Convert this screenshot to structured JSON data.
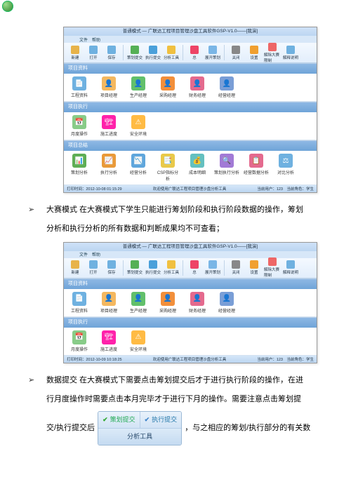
{
  "ss1": {
    "title": "普通模式 — 广联达工程项目管理沙盘工具软件GSP-V1.0——[我演]",
    "tabs": [
      "文件",
      "帮助"
    ],
    "ribbon": [
      {
        "label": "新建",
        "c": "#e7b34a"
      },
      {
        "label": "打开",
        "c": "#6fb1e0"
      },
      {
        "label": "保存",
        "c": "#6fb1e0"
      },
      {
        "label": "策划提交",
        "c": "#55b055"
      },
      {
        "label": "执行提交",
        "c": "#4aa0da"
      },
      {
        "label": "分析工具",
        "c": "#f0c040"
      },
      {
        "label": "总",
        "c": "#e46"
      },
      {
        "label": "展开策划",
        "c": "#7ab6e6"
      },
      {
        "label": "关闭",
        "c": "#888"
      },
      {
        "label": "设置",
        "c": "#f0a030"
      },
      {
        "label": "解除大赛限制",
        "c": "#e66"
      },
      {
        "label": "解释说明",
        "c": "#6fb1e0"
      }
    ],
    "sections": [
      {
        "title": "项目资料",
        "items": [
          {
            "label": "工程资料",
            "c": "#6fb1e0",
            "g": "📄"
          },
          {
            "label": "项目经理",
            "c": "#f4b860",
            "g": "👤"
          },
          {
            "label": "生产经理",
            "c": "#62c06b",
            "g": "👤"
          },
          {
            "label": "采购经理",
            "c": "#f28f3b",
            "g": "👤"
          },
          {
            "label": "财务经理",
            "c": "#e46a8e",
            "g": "👤"
          },
          {
            "label": "经营经理",
            "c": "#7a9ed6",
            "g": "👤"
          }
        ]
      },
      {
        "title": "项目执行",
        "items": [
          {
            "label": "月度操作",
            "c": "#8c8",
            "g": "📅"
          },
          {
            "label": "施工进度",
            "c": "#f2a",
            "g": "🏗"
          },
          {
            "label": "安全环境",
            "c": "#fb4",
            "g": "⚠"
          }
        ]
      },
      {
        "title": "项目总结",
        "items": [
          {
            "label": "策划分析",
            "c": "#5fae55",
            "g": "📊"
          },
          {
            "label": "执行分析",
            "c": "#e99a3a",
            "g": "📈"
          },
          {
            "label": "经营分析",
            "c": "#5fa6dc",
            "g": "📉"
          },
          {
            "label": "CSP指标分析",
            "c": "#e9c94a",
            "g": "📑"
          },
          {
            "label": "成本明细",
            "c": "#64c0c0",
            "g": "💰"
          },
          {
            "label": "策划执行分析",
            "c": "#a27ad6",
            "g": "🔍"
          },
          {
            "label": "经营数据分析",
            "c": "#e46a8e",
            "g": "📋"
          },
          {
            "label": "对比分析",
            "c": "#6fb1e0",
            "g": "⚖"
          }
        ]
      }
    ],
    "status_left": "打印时间：2012-10-08 01:15:29",
    "status_mid": "欢迎使用广联达工程项目管理沙盘分析工具",
    "status_right": "当前用户：123　当前角色：学生"
  },
  "para1_a": "大赛模式 在大赛模式下学生只能进行筹划阶段和执行阶段数据的操作，筹划",
  "para1_b": "分析和执行分析的所有数据和判断成果均不可查看；",
  "ss2": {
    "title": "普通模式 — 广联达工程项目管理沙盘工具软件GSP-V1.0——[我演]",
    "tabs": [
      "文件",
      "帮助"
    ],
    "status_left": "打印时间：2012-10-09 10:18:25",
    "status_mid": "欢迎使用广联达工程项目管理沙盘分析工具",
    "status_right": "当前用户：123　当前角色：学生"
  },
  "para2_a": "数据提交 在大赛模式下需要点击筹划提交后才于进行执行阶段的操作，在进",
  "para2_b": "行月度操作时需要点击本月完毕才于进行下月的操作。需要注意点击筹划提",
  "btns": {
    "a": "策划提交",
    "b": "执行提交",
    "c": "分析工具"
  },
  "para3_a": "交/执行提交后",
  "para3_b": "，与之相应的筹划/执行部分的有关数"
}
